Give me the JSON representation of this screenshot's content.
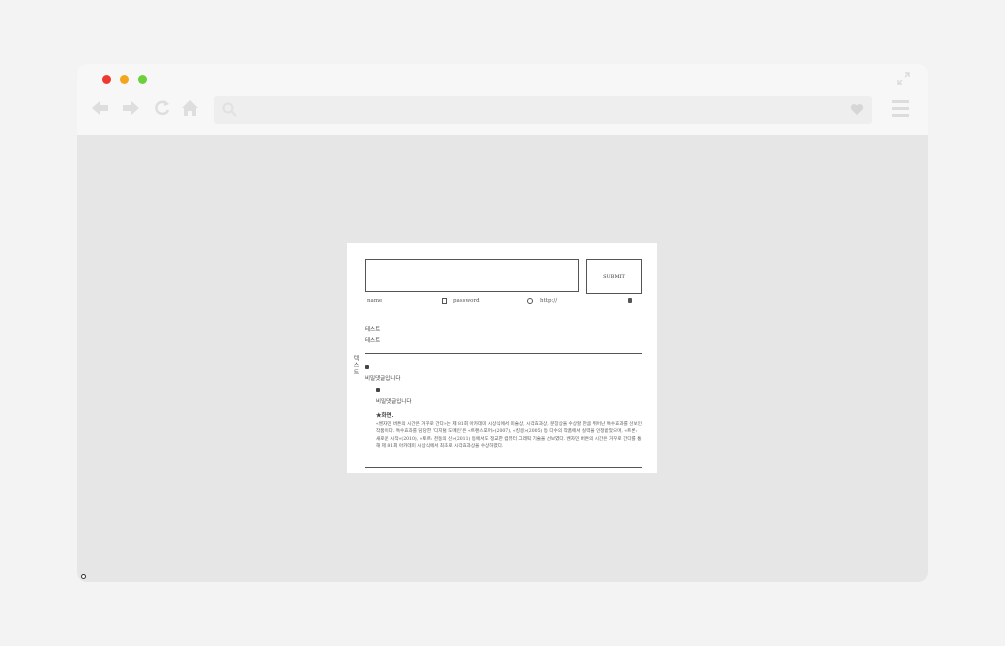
{
  "browser": {
    "icons": [
      "close-dot",
      "minimize-dot",
      "zoom-dot",
      "expand-icon",
      "back-arrow-icon",
      "forward-arrow-icon",
      "reload-icon",
      "home-icon",
      "search-icon",
      "heart-icon",
      "menu-icon"
    ],
    "colors": {
      "red": "#ee3a2e",
      "yellow": "#f4a51f",
      "green": "#6ad13a"
    }
  },
  "page": {
    "side_tab": "텍스트",
    "submit_label": "SUBMIT",
    "fields": {
      "name_placeholder": "name",
      "password_placeholder": "password",
      "url_placeholder": "http://"
    },
    "texts": [
      "테스트",
      "테스트"
    ],
    "comments": [
      {
        "text": "비밀댓글입니다"
      },
      {
        "text": "비밀댓글입니다"
      }
    ],
    "star_label": "★화면.",
    "paragraph": "«벤자민 버튼의 시간은 거꾸로 간다»는 제 81회 아카데미 시상식에서 미술상, 시각효과상, 분장상을 수상할 만큼 뛰어난 특수효과를 선보인 작품이다. 특수효과를 담당한 ‘디지털 도메인’은 «트랜스포머»(2007), «킹콩»(2005) 등 다수의 작품에서 실력을 인정받았으며, «트론: 새로운 시작»(2010), «토르: 천둥의 신»(2011) 등에서도 정교한 컴퓨터 그래픽 기술을 선보였다. 벤자민 버튼의 시간은 거꾸로 간다를 통해 제 81회 아카데미 시상식에서 최초로 시각효과상을 수상하였다."
  }
}
